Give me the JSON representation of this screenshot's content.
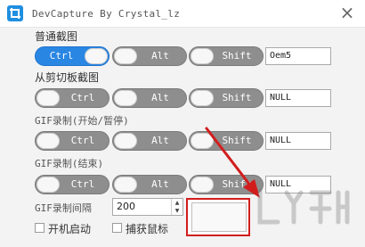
{
  "window": {
    "title": "DevCapture By Crystal_lz",
    "close_glyph": "×",
    "icon": "crop-icon"
  },
  "sections": [
    {
      "label": "普通截图",
      "ctrl": {
        "label": "Ctrl",
        "on": true
      },
      "alt": {
        "label": "Alt",
        "on": false
      },
      "shift": {
        "label": "Shift",
        "on": false
      },
      "key": "Oem5"
    },
    {
      "label": "从剪切板截图",
      "ctrl": {
        "label": "Ctrl",
        "on": false
      },
      "alt": {
        "label": "Alt",
        "on": false
      },
      "shift": {
        "label": "Shift",
        "on": false
      },
      "key": "NULL"
    },
    {
      "label": "GIF录制(开始/暂停)",
      "ctrl": {
        "label": "Ctrl",
        "on": false
      },
      "alt": {
        "label": "Alt",
        "on": false
      },
      "shift": {
        "label": "Shift",
        "on": false
      },
      "key": "NULL"
    },
    {
      "label": "GIF录制(结束)",
      "ctrl": {
        "label": "Ctrl",
        "on": false
      },
      "alt": {
        "label": "Alt",
        "on": false
      },
      "shift": {
        "label": "Shift",
        "on": false
      },
      "key": "NULL"
    }
  ],
  "gif_interval": {
    "label": "GIF录制间隔",
    "value": "200"
  },
  "checkboxes": [
    {
      "label": "开机启动",
      "checked": false
    },
    {
      "label": "捕获鼠标",
      "checked": false
    }
  ],
  "colors": {
    "accent": "#2a86e3",
    "toggle_off": "#8e8e8e",
    "highlight": "#d21d1d"
  }
}
